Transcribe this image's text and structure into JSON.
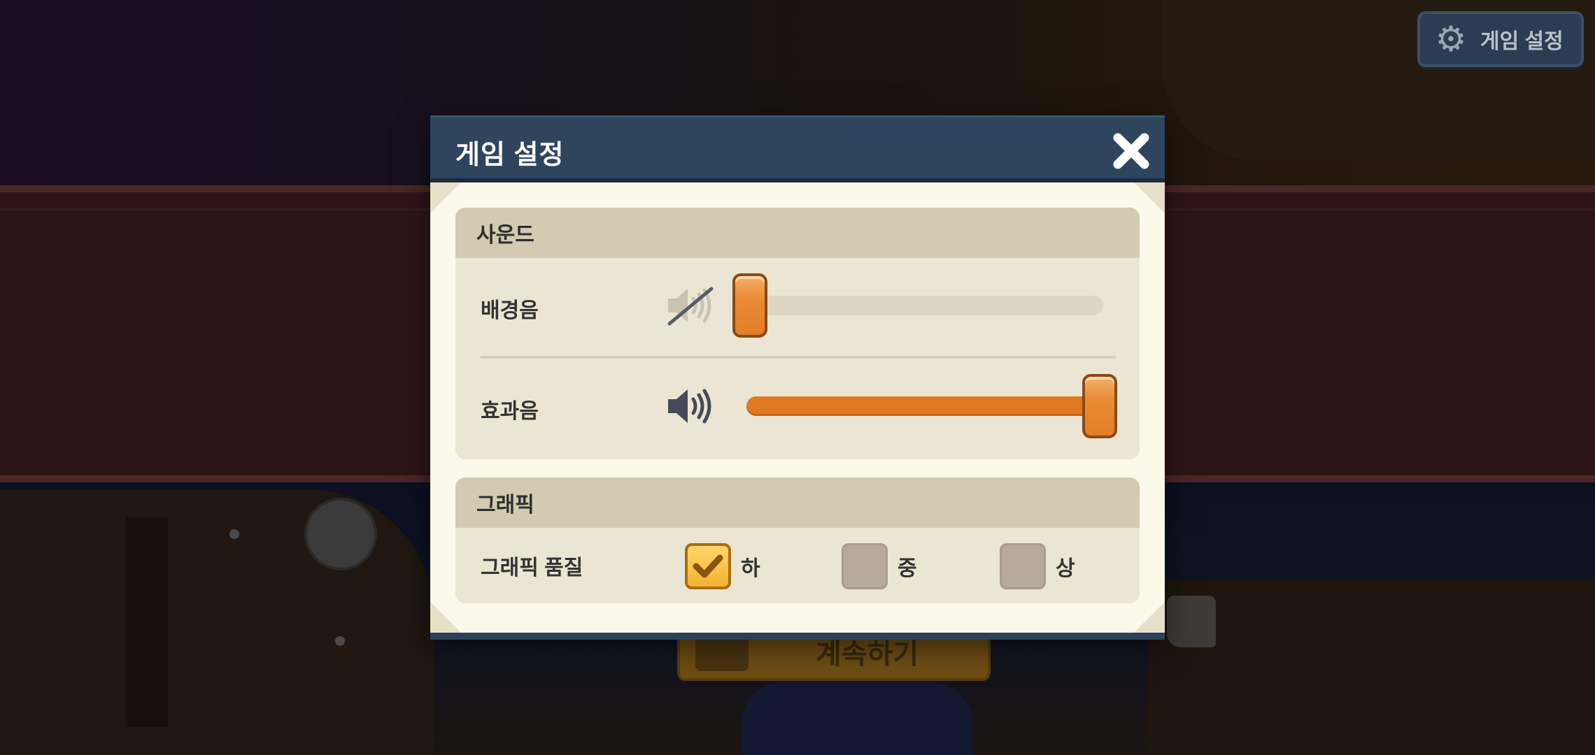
{
  "top_button": {
    "label": "게임 설정",
    "icon": "gear-icon"
  },
  "background": {
    "cta_label": "계속하기"
  },
  "modal": {
    "title": "게임 설정",
    "close_icon": "close-icon",
    "sound": {
      "title": "사운드",
      "bgm": {
        "label": "배경음",
        "icon": "speaker-muted-icon",
        "muted": true,
        "level": 0.0
      },
      "sfx": {
        "label": "효과음",
        "icon": "speaker-icon",
        "muted": false,
        "level": 1.0
      }
    },
    "graphics": {
      "title": "그래픽",
      "quality_label": "그래픽 품질",
      "options": [
        {
          "label": "하",
          "selected": true
        },
        {
          "label": "중",
          "selected": false
        },
        {
          "label": "상",
          "selected": false
        }
      ]
    }
  },
  "colors": {
    "accent_orange": "#e07a22",
    "header_navy": "#2f455e",
    "panel_cream": "#fcf8ea",
    "checkbox_gold": "#f5b32e"
  }
}
